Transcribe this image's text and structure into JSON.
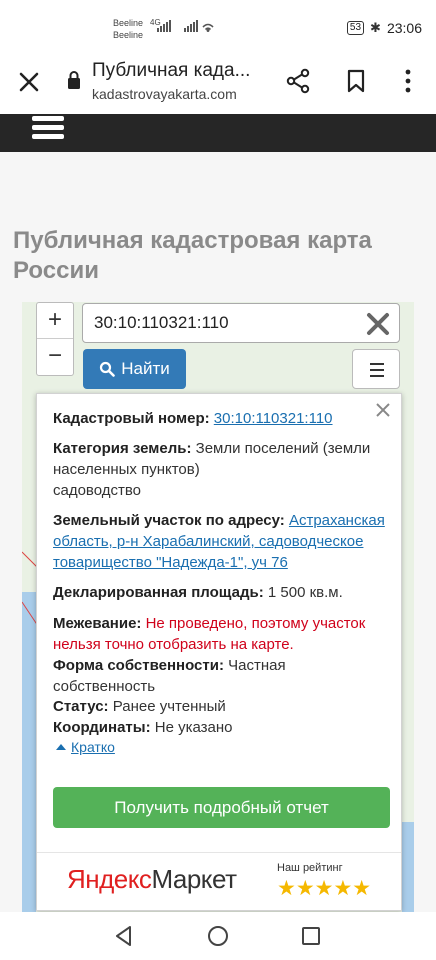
{
  "status_bar": {
    "carrier1": "Beeline",
    "carrier2": "Beeline",
    "network": "4G",
    "battery": "53",
    "time": "23:06"
  },
  "browser": {
    "page_title": "Публичная када...",
    "domain": "kadastrovayakarta.com",
    "icons": [
      "close-icon",
      "lock-icon",
      "share-icon",
      "bookmark-icon",
      "more-icon"
    ]
  },
  "site": {
    "heading": "Публичная кадастровая карта России"
  },
  "map": {
    "zoom_in": "+",
    "zoom_out": "−",
    "search_value": "30:10:110321:110",
    "search_button": "Найти"
  },
  "popup": {
    "cadastral_label": "Кадастровый номер:",
    "cadastral_value": "30:10:110321:110",
    "category_label": "Категория земель:",
    "category_value": "Земли поселений (земли населенных пунктов)",
    "category_sub": "садоводство",
    "address_label": "Земельный участок по адресу:",
    "address_value": "Астраханская область, р-н Харабалинский, садоводческое товарищество \"Надежда-1\", уч 76",
    "area_label": "Декларированная площадь:",
    "area_value": "1 500 кв.м.",
    "survey_label": "Межевание:",
    "survey_value": "Не проведено, поэтому участок нельзя точно отобразить на карте.",
    "ownership_label": "Форма собственности:",
    "ownership_value": "Частная собственность",
    "status_label": "Статус:",
    "status_value": "Ранее учтенный",
    "coords_label": "Координаты:",
    "coords_value": "Не указано",
    "brief_link": "Кратко",
    "report_button": "Получить подробный отчет",
    "market_brand_y": "Яндекс",
    "market_brand_m": "Маркет",
    "rating_label": "Наш рейтинг",
    "rating_stars": "★★★★★"
  },
  "colors": {
    "nav_dark": "#262626",
    "primary_blue": "#337ab7",
    "report_green": "#54b258",
    "warning_red": "#d0021b",
    "link_blue": "#1a6fb0",
    "star_gold": "#f5b800"
  }
}
